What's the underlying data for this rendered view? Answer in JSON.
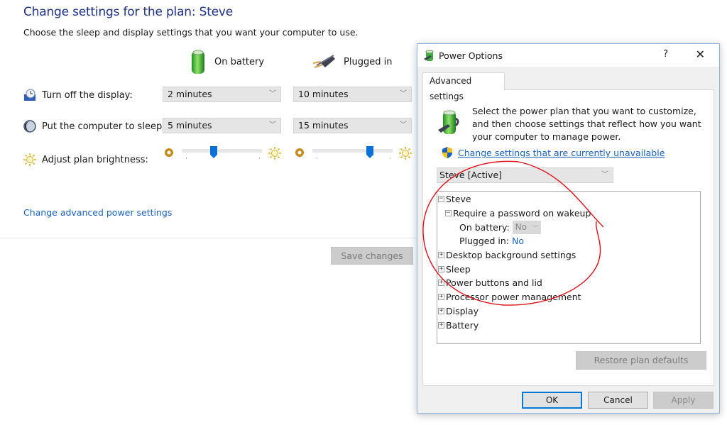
{
  "control_panel": {
    "title": "Change settings for the plan: Steve",
    "subtitle": "Choose the sleep and display settings that you want your computer to use.",
    "columns": {
      "battery": {
        "label": "On battery",
        "icon": "battery-icon"
      },
      "plugged": {
        "label": "Plugged in",
        "icon": "power-plug-icon"
      }
    },
    "rows": {
      "display": {
        "label": "Turn off the display:",
        "icon": "monitor-clock-icon",
        "battery": "2 minutes",
        "plugged": "10 minutes"
      },
      "sleep": {
        "label": "Put the computer to sleep:",
        "icon": "moon-icon",
        "battery": "5 minutes",
        "plugged": "15 minutes"
      },
      "brightness": {
        "label": "Adjust plan brightness:",
        "icon": "sun-icon",
        "battery_percent": 40,
        "plugged_percent": 72
      }
    },
    "advanced_link": "Change advanced power settings",
    "save_button": "Save changes"
  },
  "dialog": {
    "title": "Power Options",
    "help": "?",
    "close": "✕",
    "tab": "Advanced settings",
    "description": "Select the power plan that you want to customize, and then choose settings that reflect how you want your computer to manage power.",
    "unavailable_link": "Change settings that are currently unavailable",
    "plan_select": "Steve [Active]",
    "tree": [
      {
        "label": "Steve",
        "expander": "−",
        "level": 1
      },
      {
        "label": "Require a password on wakeup",
        "expander": "−",
        "level": 2
      },
      {
        "label": "On battery:",
        "value": "No",
        "value_type": "disabled-combo",
        "level": 3
      },
      {
        "label": "Plugged in:",
        "value": "No",
        "value_type": "link",
        "level": 3
      },
      {
        "label": "Desktop background settings",
        "expander": "+",
        "level": 1
      },
      {
        "label": "Sleep",
        "expander": "+",
        "level": 1
      },
      {
        "label": "Power buttons and lid",
        "expander": "+",
        "level": 1
      },
      {
        "label": "Processor power management",
        "expander": "+",
        "level": 1
      },
      {
        "label": "Display",
        "expander": "+",
        "level": 1
      },
      {
        "label": "Battery",
        "expander": "+",
        "level": 1
      }
    ],
    "restore_button": "Restore plan defaults",
    "buttons": {
      "ok": "OK",
      "cancel": "Cancel",
      "apply": "Apply"
    }
  },
  "colors": {
    "title_blue": "#1e3287",
    "link_blue": "#1a64c2",
    "slider_accent": "#0a6fd8",
    "annotation_red": "#e0101a"
  }
}
